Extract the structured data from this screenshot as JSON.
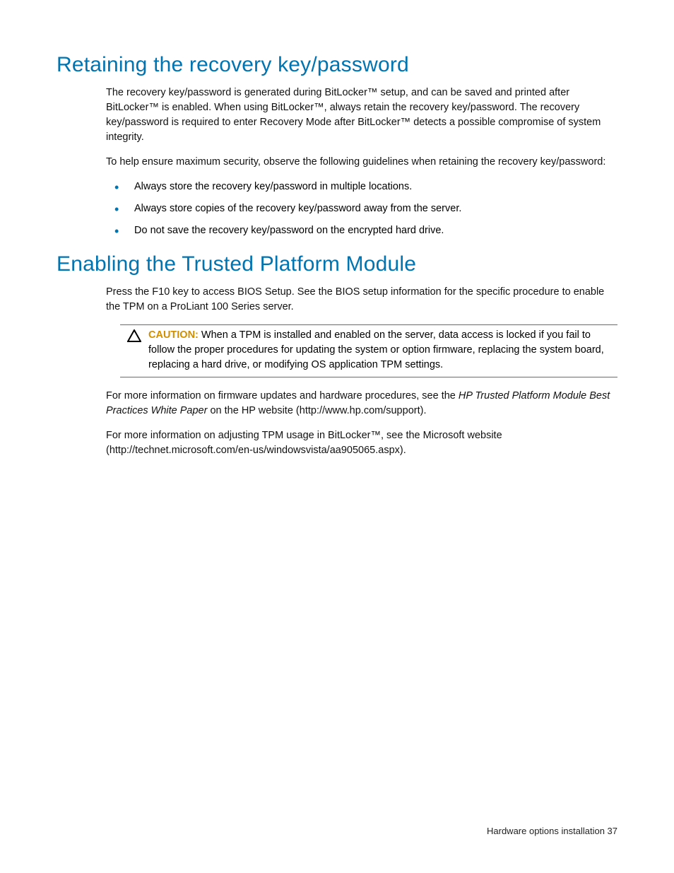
{
  "section1": {
    "heading": "Retaining the recovery key/password",
    "para1": "The recovery key/password is generated during BitLocker™ setup, and can be saved and printed after BitLocker™ is enabled. When using BitLocker™, always retain the recovery key/password. The recovery key/password is required to enter Recovery Mode after BitLocker™ detects a possible compromise of system integrity.",
    "para2": "To help ensure maximum security, observe the following guidelines when retaining the recovery key/password:",
    "bullets": [
      "Always store the recovery key/password in multiple locations.",
      "Always store copies of the recovery key/password away from the server.",
      "Do not save the recovery key/password on the encrypted hard drive."
    ]
  },
  "section2": {
    "heading": "Enabling the Trusted Platform Module",
    "para1": "Press the F10 key to access BIOS Setup. See the BIOS setup information for the specific procedure to enable the TPM on a ProLiant 100 Series server.",
    "caution_label": "CAUTION:",
    "caution_text": "When a TPM is installed and enabled on the server, data access is locked if you fail to follow the proper procedures for updating the system or option firmware, replacing the system board, replacing a hard drive, or modifying OS application TPM settings.",
    "para2_pre": "For more information on firmware updates and hardware procedures, see the ",
    "para2_italic": "HP Trusted Platform Module Best Practices White Paper",
    "para2_post": " on the HP website (http://www.hp.com/support).",
    "para3": "For more information on adjusting TPM usage in BitLocker™, see the Microsoft website (http://technet.microsoft.com/en-us/windowsvista/aa905065.aspx)."
  },
  "footer": {
    "text": "Hardware options installation   37"
  }
}
